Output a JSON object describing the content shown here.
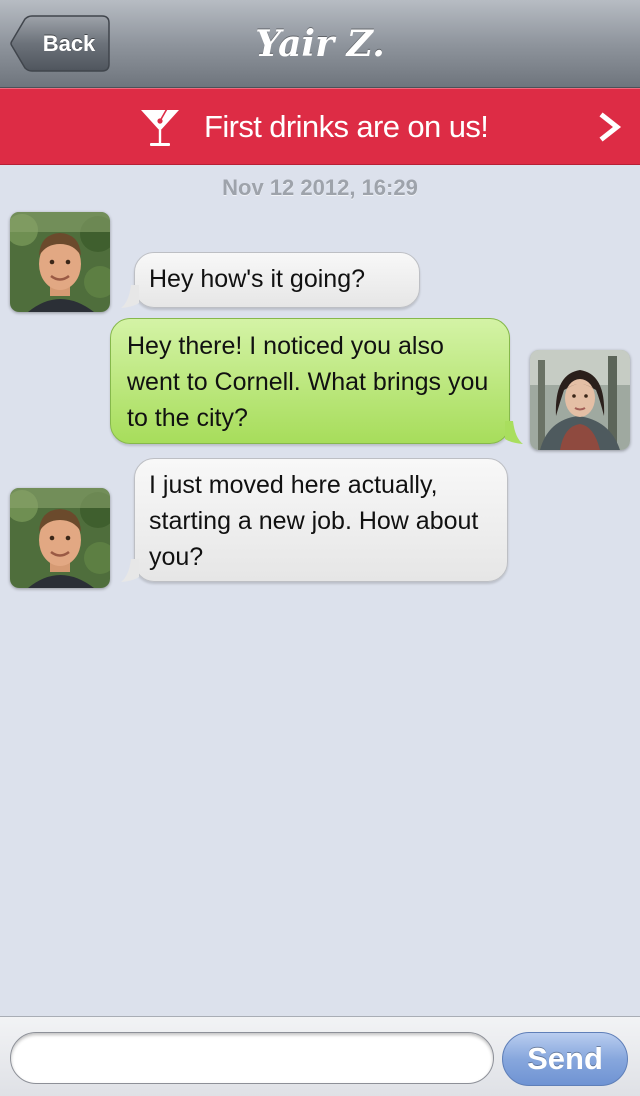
{
  "nav": {
    "back_label": "Back",
    "title": "Yair Z."
  },
  "promo": {
    "icon": "martini-icon",
    "text": "First drinks are on us!",
    "chevron_icon": "chevron-right-icon"
  },
  "conversation": {
    "timestamp": "Nov 12 2012, 16:29",
    "messages": [
      {
        "sender": "Yair Z.",
        "direction": "incoming",
        "text": "Hey how's it going?"
      },
      {
        "sender": "me",
        "direction": "outgoing",
        "text": "Hey there! I noticed you also went to Cornell. What brings you to the city?"
      },
      {
        "sender": "Yair Z.",
        "direction": "incoming",
        "text": "I just moved here actually, starting a new job. How about you?"
      }
    ]
  },
  "composer": {
    "input_value": "",
    "placeholder": "",
    "send_label": "Send"
  },
  "colors": {
    "promo_red": "#dd2c45",
    "outgoing_bubble": "#a7dd5b",
    "incoming_bubble": "#ececec",
    "send_button": "#87a7dd",
    "chat_background": "#dce1ec"
  }
}
